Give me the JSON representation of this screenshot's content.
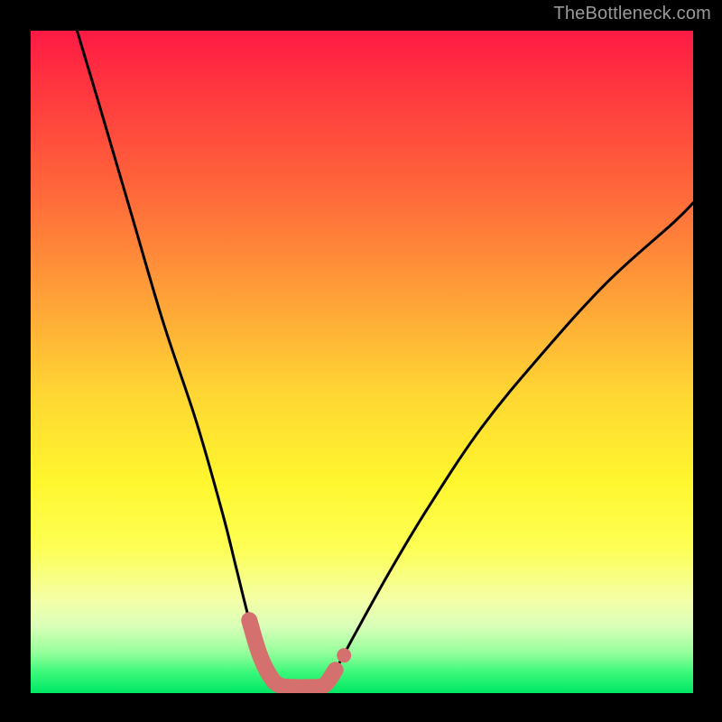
{
  "watermark": "TheBottleneck.com",
  "chart_data": {
    "type": "line",
    "title": "",
    "xlabel": "",
    "ylabel": "",
    "xlim": [
      0,
      100
    ],
    "ylim": [
      0,
      100
    ],
    "grid": false,
    "legend": false,
    "series": [
      {
        "name": "left-branch",
        "x": [
          7,
          10,
          15,
          20,
          25,
          29,
          31,
          33,
          34.5,
          36,
          37.5
        ],
        "y": [
          100,
          90,
          73,
          56,
          41,
          27,
          19,
          11,
          6,
          2.8,
          1.2
        ]
      },
      {
        "name": "floor",
        "x": [
          37.5,
          40,
          42,
          44.3
        ],
        "y": [
          1.2,
          0.9,
          0.9,
          1.2
        ]
      },
      {
        "name": "right-branch",
        "x": [
          44.3,
          46,
          49,
          54,
          60,
          68,
          77,
          87,
          97,
          100
        ],
        "y": [
          1.2,
          3.5,
          9,
          18,
          28,
          40,
          51,
          62,
          71,
          74
        ]
      }
    ],
    "highlight_segment": {
      "name": "bottom-highlight",
      "color": "#d4716f",
      "x": [
        33,
        34.5,
        36,
        37.5,
        40,
        42,
        44.3,
        46
      ],
      "y": [
        11,
        6,
        2.8,
        1.2,
        0.9,
        0.9,
        1.2,
        3.5
      ]
    },
    "highlight_point": {
      "name": "marker-dot",
      "color": "#d4716f",
      "x": 47.3,
      "y": 5.7
    }
  },
  "colors": {
    "background": "#000000",
    "curve": "#000000",
    "highlight": "#d4716f",
    "watermark": "#999999"
  }
}
